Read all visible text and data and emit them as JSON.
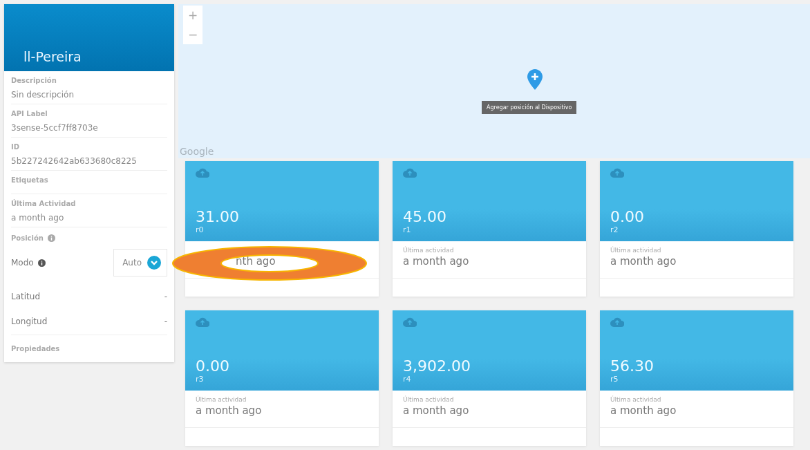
{
  "sidebar": {
    "title": "ll-Pereira",
    "fields": [
      {
        "label": "Descripción",
        "value": "Sin descripción"
      },
      {
        "label": "API Label",
        "value": "3sense-5ccf7ff8703e"
      },
      {
        "label": "ID",
        "value": "5b227242642ab633680c8225"
      },
      {
        "label": "Etiquetas"
      },
      {
        "label": "Última Actividad",
        "value": "a month ago"
      }
    ],
    "position": {
      "label": "Posición",
      "mode_label": "Modo",
      "mode_value": "Auto",
      "coords": [
        {
          "label": "Latitud",
          "value": "-"
        },
        {
          "label": "Longitud",
          "value": "-"
        }
      ]
    },
    "properties_label": "Propiedades"
  },
  "map": {
    "zoom_in": "+",
    "zoom_out": "−",
    "tooltip": "Agregar posición al Dispositivo",
    "logo": "Google"
  },
  "annotation": {
    "kind": "ring"
  },
  "cards": [
    {
      "value": "31.00",
      "name": "r0",
      "activity": "nth ago"
    },
    {
      "value": "45.00",
      "name": "r1",
      "activity_label": "Última actividad",
      "activity": "a month ago"
    },
    {
      "value": "0.00",
      "name": "r2",
      "activity_label": "Última actividad",
      "activity": "a month ago"
    },
    {
      "value": "0.00",
      "name": "r3",
      "activity_label": "Última actividad",
      "activity": "a month ago"
    },
    {
      "value": "3,902.00",
      "name": "r4",
      "activity_label": "Última actividad",
      "activity": "a month ago"
    },
    {
      "value": "56.30",
      "name": "r5",
      "activity_label": "Última actividad",
      "activity": "a month ago"
    }
  ]
}
